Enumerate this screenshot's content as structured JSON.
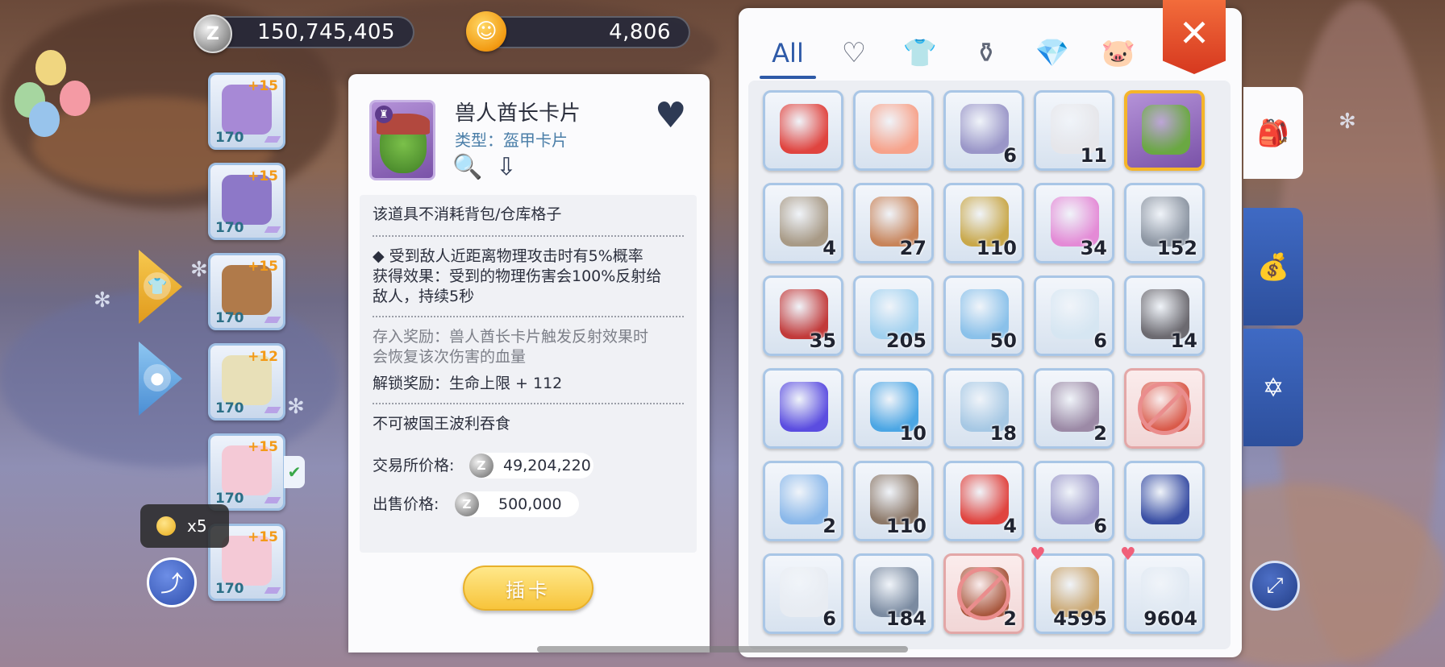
{
  "currency": {
    "zeny": "150,745,405",
    "cat_coin": "4,806",
    "zeny_icon": "zeny-coin-icon",
    "cat_icon": "cat-coin-icon"
  },
  "equipment": [
    {
      "level": "170",
      "refine": "+15",
      "color": "#a789d6"
    },
    {
      "level": "170",
      "refine": "+15",
      "color": "#8d78c8"
    },
    {
      "level": "170",
      "refine": "+15",
      "color": "#b07a4a"
    },
    {
      "level": "170",
      "refine": "+12",
      "color": "#e8e0b8"
    },
    {
      "level": "170",
      "refine": "+15",
      "color": "#f4c9d6"
    },
    {
      "level": "170",
      "refine": "+15",
      "color": "#f4c9d6"
    }
  ],
  "tooltip": {
    "count": "x5"
  },
  "detail": {
    "name": "兽人酋长卡片",
    "type": "类型：盔甲卡片",
    "no_space": "该道具不消耗背包/仓库格子",
    "effect_1": "◆ 受到敌人近距离物理攻击时有5%概率",
    "effect_2": "获得效果：受到的物理伤害会100%反射给",
    "effect_3": "敌人，持续5秒",
    "deposit_1": "存入奖励：兽人酋长卡片触发反射效果时",
    "deposit_2": "会恢复该次伤害的血量",
    "unlock": "解锁奖励：生命上限 + 112",
    "no_devour": "不可被国王波利吞食",
    "exchange_label": "交易所价格:",
    "exchange_price": "49,204,220",
    "sell_label": "出售价格:",
    "sell_price": "500,000",
    "insert_button": "插卡"
  },
  "inventory": {
    "tabs": [
      {
        "label": "All",
        "icon": "all-tab"
      },
      {
        "label": "♡",
        "icon": "heart-icon"
      },
      {
        "label": "👕",
        "icon": "shirt-icon"
      },
      {
        "label": "⚱",
        "icon": "potion-icon"
      },
      {
        "label": "💎",
        "icon": "diamond-icon"
      },
      {
        "label": "🐷",
        "icon": "card-icon"
      }
    ],
    "close_label": "✕",
    "items": [
      {
        "count": "",
        "color": "#e0443f",
        "name": "red-bag"
      },
      {
        "count": "",
        "color": "#f7a28a",
        "name": "potion-flask"
      },
      {
        "count": "6",
        "color": "#9a96c8",
        "name": "disc"
      },
      {
        "count": "11",
        "color": "#e6e6ea",
        "name": "white-jar"
      },
      {
        "count": "",
        "color": "#6aa842",
        "name": "orc-card",
        "selected": true
      },
      {
        "count": "4",
        "color": "#a89a86",
        "name": "button-coin"
      },
      {
        "count": "27",
        "color": "#c8845a",
        "name": "skull-mask"
      },
      {
        "count": "110",
        "color": "#c9a84a",
        "name": "fish-lure"
      },
      {
        "count": "34",
        "color": "#e48ad6",
        "name": "pink-glow"
      },
      {
        "count": "152",
        "color": "#8c95a2",
        "name": "stone"
      },
      {
        "count": "35",
        "color": "#c23a3a",
        "name": "stocking"
      },
      {
        "count": "205",
        "color": "#9fd0ef",
        "name": "ice-crystal"
      },
      {
        "count": "50",
        "color": "#8ac1ea",
        "name": "snowflake"
      },
      {
        "count": "6",
        "color": "#d6e6f2",
        "name": "snow-pile"
      },
      {
        "count": "14",
        "color": "#6c6a70",
        "name": "dark-ball"
      },
      {
        "count": "",
        "color": "#5b4de0",
        "name": "purple-flame"
      },
      {
        "count": "10",
        "color": "#4ca6e4",
        "name": "blue-gem"
      },
      {
        "count": "18",
        "color": "#a6c8e4",
        "name": "crystal-shard"
      },
      {
        "count": "2",
        "color": "#9c8aa6",
        "name": "gray-rock"
      },
      {
        "count": "",
        "color": "#d95a4a",
        "name": "locked-feather",
        "locked": true
      },
      {
        "count": "2",
        "color": "#8ab8ea",
        "name": "ice-spikes"
      },
      {
        "count": "110",
        "color": "#8c7868",
        "name": "horn"
      },
      {
        "count": "4",
        "color": "#e0443f",
        "name": "red-orb"
      },
      {
        "count": "6",
        "color": "#9a96c8",
        "name": "disc-2"
      },
      {
        "count": "",
        "color": "#3a4fa4",
        "name": "boots"
      },
      {
        "count": "6",
        "color": "#e8ecf2",
        "name": "cloth"
      },
      {
        "count": "184",
        "color": "#7a8aa0",
        "name": "chest"
      },
      {
        "count": "2",
        "color": "#a8583e",
        "name": "locked-branch",
        "locked": true
      },
      {
        "count": "4595",
        "color": "#c9a36a",
        "name": "butterfly-wing",
        "fav": true
      },
      {
        "count": "9604",
        "color": "#dfe8f2",
        "name": "feather",
        "fav": true
      }
    ]
  },
  "side_tabs": [
    {
      "icon": "backpack-icon",
      "glyph": "🎒"
    },
    {
      "icon": "zeny-bag-icon",
      "glyph": "💰"
    },
    {
      "icon": "hexagram-icon",
      "glyph": "✡"
    }
  ],
  "corner_button_glyph": "⤢"
}
